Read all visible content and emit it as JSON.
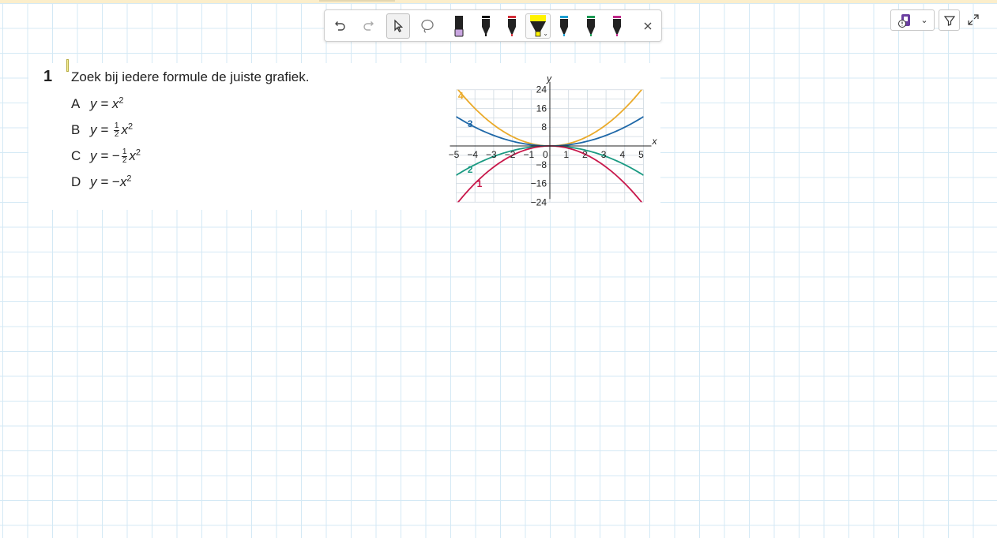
{
  "toolbar": {
    "tools": [
      {
        "name": "undo-icon"
      },
      {
        "name": "redo-icon"
      },
      {
        "name": "select-arrow-icon",
        "selected": true
      },
      {
        "name": "lasso-icon"
      },
      {
        "name": "eraser-pen-icon",
        "color": "#c9a6e0"
      },
      {
        "name": "pen-black-icon",
        "color": "#111111"
      },
      {
        "name": "pen-red-icon",
        "color": "#d32f3a"
      },
      {
        "name": "highlighter-yellow-icon",
        "color": "#fff200",
        "selected": true
      },
      {
        "name": "pen-cyan-icon",
        "color": "#1ea0d2"
      },
      {
        "name": "pen-green-icon",
        "color": "#1c9a55"
      },
      {
        "name": "pen-magenta-icon",
        "color": "#c0298a"
      }
    ],
    "close_icon": "close-icon"
  },
  "controls": {
    "record_icon": "record-audio-icon",
    "filter_icon": "pen-filter-icon",
    "expand_icon": "expand-icon"
  },
  "exercise": {
    "number": "1",
    "question": "Zoek bij iedere formule de juiste grafiek.",
    "options": [
      {
        "letter": "A",
        "lhs": "y = ",
        "sign": "",
        "frac": null,
        "var": "x",
        "exp": "2"
      },
      {
        "letter": "B",
        "lhs": "y = ",
        "sign": "",
        "frac": {
          "num": "1",
          "den": "2"
        },
        "var": "x",
        "exp": "2"
      },
      {
        "letter": "C",
        "lhs": "y = ",
        "sign": "−",
        "frac": {
          "num": "1",
          "den": "2"
        },
        "var": "x",
        "exp": "2"
      },
      {
        "letter": "D",
        "lhs": "y = ",
        "sign": "−",
        "frac": null,
        "var": "x",
        "exp": "2"
      }
    ]
  },
  "chart_data": {
    "type": "line",
    "xlabel": "x",
    "ylabel": "y",
    "xlim": [
      -5,
      5
    ],
    "ylim": [
      -24,
      24
    ],
    "x_ticks": [
      -5,
      -4,
      -3,
      -2,
      -1,
      0,
      1,
      2,
      3,
      4,
      5
    ],
    "x_tick_labels": [
      "−5",
      "−4",
      "−3",
      "−2",
      "−1",
      "0",
      "1",
      "2",
      "3",
      "4",
      "5"
    ],
    "y_ticks": [
      24,
      16,
      8,
      -8,
      -16,
      -24
    ],
    "y_tick_labels": [
      "24",
      "16",
      "8",
      "−8",
      "−16",
      "−24"
    ],
    "grid": true,
    "series": [
      {
        "name": "4",
        "color": "#eaaa2a",
        "x": [
          -5,
          -4,
          -3,
          -2,
          -1,
          0,
          1,
          2,
          3,
          4,
          5
        ],
        "y": [
          25,
          16,
          9,
          4,
          1,
          0,
          1,
          4,
          9,
          16,
          25
        ]
      },
      {
        "name": "3",
        "color": "#1f68a8",
        "x": [
          -5,
          -4,
          -3,
          -2,
          -1,
          0,
          1,
          2,
          3,
          4,
          5
        ],
        "y": [
          12.5,
          8,
          4.5,
          2,
          0.5,
          0,
          0.5,
          2,
          4.5,
          8,
          12.5
        ]
      },
      {
        "name": "2",
        "color": "#1a9a82",
        "x": [
          -5,
          -4,
          -3,
          -2,
          -1,
          0,
          1,
          2,
          3,
          4,
          5
        ],
        "y": [
          -12.5,
          -8,
          -4.5,
          -2,
          -0.5,
          0,
          -0.5,
          -2,
          -4.5,
          -8,
          -12.5
        ]
      },
      {
        "name": "1",
        "color": "#c8184b",
        "x": [
          -5,
          -4,
          -3,
          -2,
          -1,
          0,
          1,
          2,
          3,
          4,
          5
        ],
        "y": [
          -25,
          -16,
          -9,
          -4,
          -1,
          0,
          -1,
          -4,
          -9,
          -16,
          -25
        ]
      }
    ]
  }
}
